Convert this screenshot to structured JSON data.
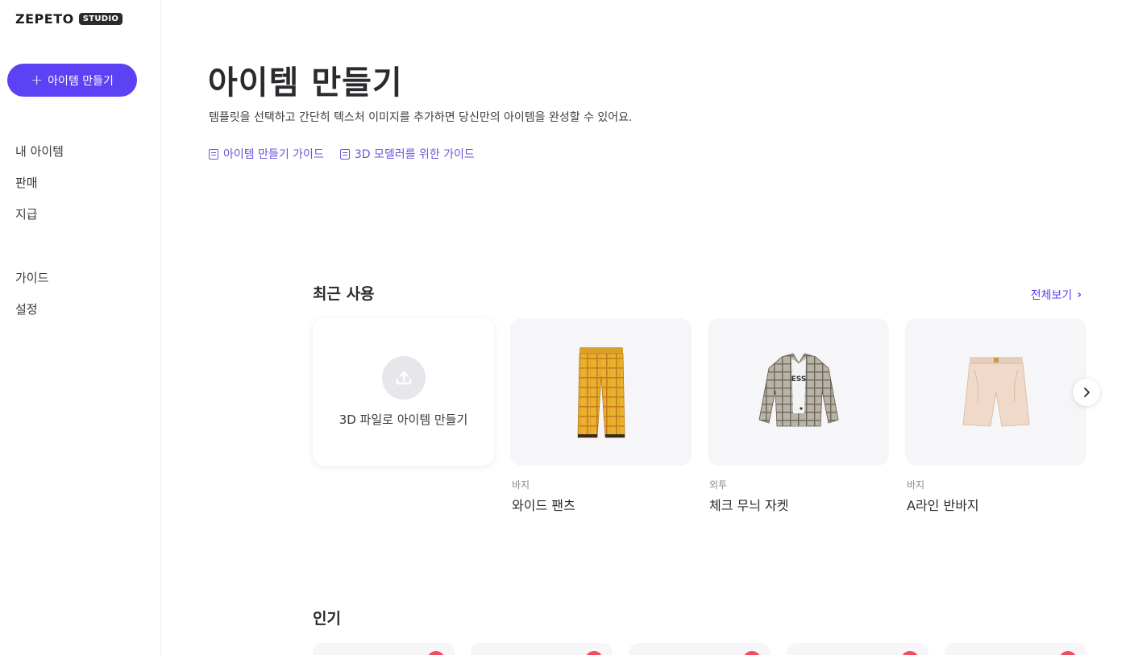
{
  "brand": {
    "logo": "ZEPETO",
    "studio_badge": "STUDIO"
  },
  "sidebar": {
    "create_button": "아이템 만들기",
    "nav_primary": [
      {
        "label": "내 아이템"
      },
      {
        "label": "판매"
      },
      {
        "label": "지급"
      }
    ],
    "nav_secondary": [
      {
        "label": "가이드"
      },
      {
        "label": "설정"
      }
    ]
  },
  "header": {
    "title": "아이템 만들기",
    "description": "템플릿을 선택하고 간단히 텍스처 이미지를 추가하면 당신만의 아이템을 완성할 수 있어요.",
    "guide_links": [
      {
        "label": "아이템 만들기 가이드"
      },
      {
        "label": "3D 모델러를 위한 가이드"
      }
    ]
  },
  "recent": {
    "title": "최근 사용",
    "see_all": "전체보기",
    "upload_card_label": "3D 파일로 아이템 만들기",
    "items": [
      {
        "category": "바지",
        "name": "와이드 팬츠",
        "icon": "plaid-pants-image"
      },
      {
        "category": "외투",
        "name": "체크 무늬 자켓",
        "icon": "plaid-jacket-image"
      },
      {
        "category": "바지",
        "name": "A라인 반바지",
        "icon": "shorts-image"
      }
    ]
  },
  "popular": {
    "title": "인기"
  },
  "colors": {
    "accent": "#5d41f5",
    "link": "#6a54d8",
    "badge": "#f04e60"
  }
}
